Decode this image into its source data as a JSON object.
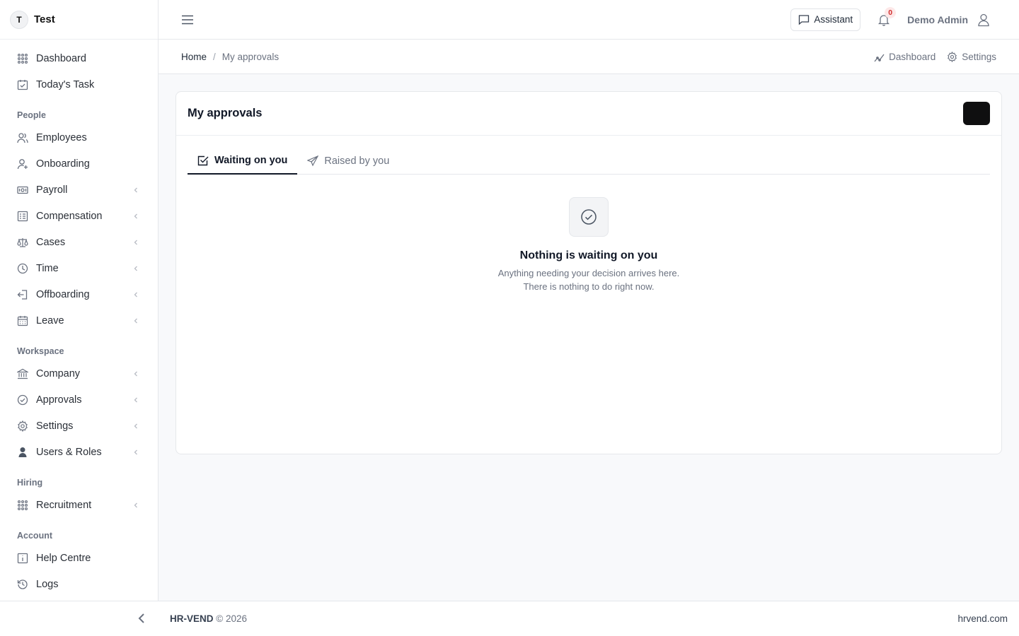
{
  "brand": {
    "initial": "T",
    "name": "Test"
  },
  "sidebar": {
    "top_items": [
      {
        "label": "Dashboard",
        "icon": "grid-icon"
      },
      {
        "label": "Today's Task",
        "icon": "calendar-check-icon"
      }
    ],
    "sections": [
      {
        "title": "People",
        "items": [
          {
            "label": "Employees",
            "icon": "users-icon",
            "chevron": false
          },
          {
            "label": "Onboarding",
            "icon": "user-plus-icon",
            "chevron": false
          },
          {
            "label": "Payroll",
            "icon": "banknote-icon",
            "chevron": true
          },
          {
            "label": "Compensation",
            "icon": "list-icon",
            "chevron": true
          },
          {
            "label": "Cases",
            "icon": "scale-icon",
            "chevron": true
          },
          {
            "label": "Time",
            "icon": "clock-icon",
            "chevron": true
          },
          {
            "label": "Offboarding",
            "icon": "log-out-icon",
            "chevron": true
          },
          {
            "label": "Leave",
            "icon": "calendar-icon",
            "chevron": true
          }
        ]
      },
      {
        "title": "Workspace",
        "items": [
          {
            "label": "Company",
            "icon": "bank-icon",
            "chevron": true
          },
          {
            "label": "Approvals",
            "icon": "check-circle-icon",
            "chevron": true
          },
          {
            "label": "Settings",
            "icon": "gear-icon",
            "chevron": true
          },
          {
            "label": "Users & Roles",
            "icon": "user-shield-icon",
            "chevron": true
          }
        ]
      },
      {
        "title": "Hiring",
        "items": [
          {
            "label": "Recruitment",
            "icon": "grid-icon",
            "chevron": true
          }
        ]
      },
      {
        "title": "Account",
        "items": [
          {
            "label": "Help Centre",
            "icon": "info-icon",
            "chevron": false
          },
          {
            "label": "Logs",
            "icon": "history-icon",
            "chevron": false
          }
        ]
      }
    ]
  },
  "header": {
    "assistant_label": "Assistant",
    "notification_count": "0",
    "user_name": "Demo Admin"
  },
  "breadcrumb": {
    "home": "Home",
    "separator": "/",
    "current": "My approvals",
    "links": {
      "dashboard": "Dashboard",
      "settings": "Settings"
    }
  },
  "card": {
    "title": "My approvals",
    "tabs": [
      {
        "label": "Waiting on you",
        "active": true,
        "icon": "check-square-icon"
      },
      {
        "label": "Raised by you",
        "active": false,
        "icon": "send-icon"
      }
    ],
    "empty": {
      "title": "Nothing is waiting on you",
      "line1": "Anything needing your decision arrives here.",
      "line2": "There is nothing to do right now."
    }
  },
  "footer": {
    "brand": "HR-VEND",
    "copyright": "© 2026",
    "link": "hrvend.com"
  },
  "colors": {
    "accent": "#111827",
    "badge_text": "#d12c2c",
    "badge_bg": "#fde8e8",
    "muted": "#6b7280"
  }
}
